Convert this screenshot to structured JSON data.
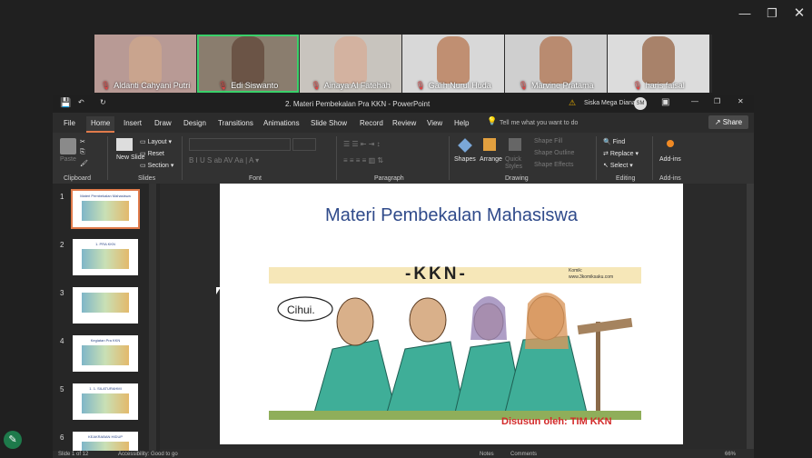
{
  "participants": [
    {
      "name": "Aldanti Cahyani Putri",
      "skin": "#c9a48e",
      "bg": "#b89a95"
    },
    {
      "name": "Edi Siswanto",
      "skin": "#6b5446",
      "bg": "#8a7d6e",
      "active": true
    },
    {
      "name": "Ainaya Al Fatehah",
      "skin": "#d3b2a0",
      "bg": "#c8c4be"
    },
    {
      "name": "Galih Nurul Huda",
      "skin": "#c08f72",
      "bg": "#d8d8d8"
    },
    {
      "name": "Marvine Pratama",
      "skin": "#b98b70",
      "bg": "#cfcfcf"
    },
    {
      "name": "haris faisal",
      "skin": "#a8826a",
      "bg": "#dcdcdc"
    }
  ],
  "window": {
    "title": "2. Materi Pembekalan Pra KKN  -  PowerPoint",
    "user": "Siska Mega Diana",
    "user_initials": "SM"
  },
  "ribbon_tabs": [
    "File",
    "Home",
    "Insert",
    "Draw",
    "Design",
    "Transitions",
    "Animations",
    "Slide Show",
    "Record",
    "Review",
    "View",
    "Help"
  ],
  "active_tab": "Home",
  "tell_me": "Tell me what you want to do",
  "share_label": "Share",
  "ribbon": {
    "clipboard": {
      "paste": "Paste",
      "label": "Clipboard"
    },
    "slides": {
      "new_slide": "New Slide",
      "layout": "Layout",
      "reset": "Reset",
      "section": "Section",
      "label": "Slides"
    },
    "font_label": "Font",
    "paragraph_label": "Paragraph",
    "drawing": {
      "shapes": "Shapes",
      "arrange": "Arrange",
      "quick_styles": "Quick Styles",
      "fill": "Shape Fill",
      "outline": "Shape Outline",
      "effects": "Shape Effects",
      "label": "Drawing"
    },
    "editing": {
      "find": "Find",
      "replace": "Replace",
      "select": "Select",
      "label": "Editing"
    },
    "addins": {
      "addins": "Add-ins",
      "label": "Add-ins"
    }
  },
  "thumbnails": [
    {
      "num": "1",
      "title": "Materi Pembekalan Mahasiswa"
    },
    {
      "num": "2",
      "title": "1. PRA KKN"
    },
    {
      "num": "3",
      "title": ""
    },
    {
      "num": "4",
      "title": "Kegiatan Pra KKN"
    },
    {
      "num": "5",
      "title": "1. 1. SILATURAHMI"
    },
    {
      "num": "6",
      "title": "KEAKRABAN HIDUP"
    }
  ],
  "slide": {
    "title": "Materi Pembekalan Mahasiswa",
    "banner": "-KKN-",
    "credit_line1": "Komik:",
    "credit_line2": "www.3komiksaku.com",
    "speech": "Cihui.",
    "footer_label": "Disusun oleh:",
    "footer_value": "TIM KKN"
  },
  "status": {
    "slide_info": "Slide 1 of 12",
    "accessibility": "Accessibility: Good to go",
    "notes": "Notes",
    "comments": "Comments",
    "zoom": "66%"
  }
}
